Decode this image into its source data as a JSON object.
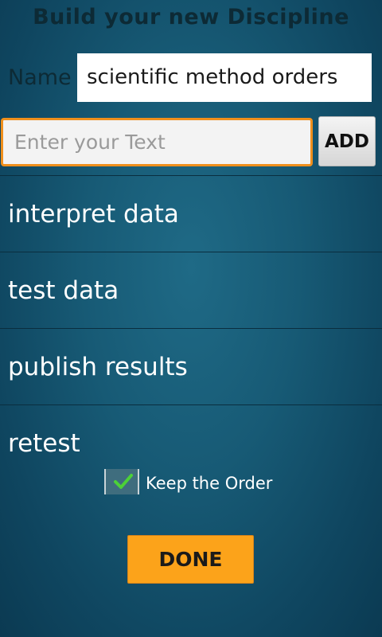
{
  "header": {
    "title": "Build your new Discipline"
  },
  "name_row": {
    "label": "Name",
    "value": "scientific method orders"
  },
  "entry": {
    "placeholder": "Enter your Text",
    "add_label": "ADD"
  },
  "items": [
    {
      "label": "interpret data"
    },
    {
      "label": "test data"
    },
    {
      "label": "publish results"
    },
    {
      "label": "retest"
    }
  ],
  "keep_order": {
    "label": "Keep the Order",
    "checked": true
  },
  "done_label": "DONE",
  "colors": {
    "accent": "#ef8f1c",
    "done_button": "#fca31a",
    "background": "#175a75",
    "check": "#4cd137"
  }
}
